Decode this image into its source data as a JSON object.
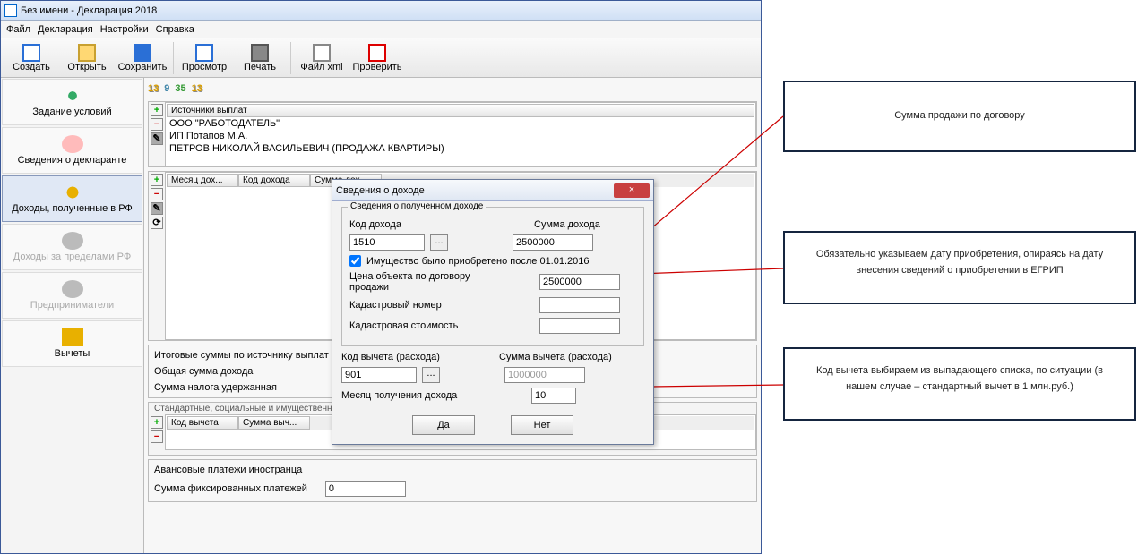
{
  "window": {
    "title": "Без имени - Декларация 2018"
  },
  "menu": {
    "file": "Файл",
    "decl": "Декларация",
    "settings": "Настройки",
    "help": "Справка"
  },
  "toolbar": {
    "create": "Создать",
    "open": "Открыть",
    "save": "Сохранить",
    "preview": "Просмотр",
    "print": "Печать",
    "xml": "Файл xml",
    "check": "Проверить"
  },
  "sidebar": {
    "conditions": "Задание условий",
    "declarant": "Сведения о декларанте",
    "income_rf": "Доходы, полученные в РФ",
    "income_abroad": "Доходы за пределами РФ",
    "entrepreneurs": "Предприниматели",
    "deductions": "Вычеты"
  },
  "nums": {
    "a": "13",
    "b": "9",
    "c": "35",
    "d": "13"
  },
  "sources": {
    "header": "Источники выплат",
    "rows": [
      "ООО \"РАБОТОДАТЕЛЬ\"",
      "ИП Потапов М.А.",
      "ПЕТРОВ НИКОЛАЙ ВАСИЛЬЕВИЧ (ПРОДАЖА КВАРТИРЫ)"
    ]
  },
  "income_table": {
    "cols": [
      "Месяц дох...",
      "Код дохода",
      "Сумма дох..."
    ]
  },
  "summary": {
    "title": "Итоговые суммы по источнику выплат",
    "total_income_label": "Общая сумма дохода",
    "tax_withheld_label": "Сумма налога удержанная"
  },
  "deduction_table": {
    "header": "Стандартные, социальные и имущественные",
    "cols": [
      "Код вычета",
      "Сумма выч..."
    ]
  },
  "advance": {
    "header": "Авансовые платежи иностранца",
    "label": "Сумма фиксированных платежей",
    "value": "0"
  },
  "dialog": {
    "title": "Сведения о доходе",
    "group_title": "Сведения о полученном доходе",
    "code_label": "Код дохода",
    "sum_label": "Сумма дохода",
    "code_value": "1510",
    "sum_value": "2500000",
    "checkbox": "Имущество было приобретено после 01.01.2016",
    "price_label": "Цена объекта по договору продажи",
    "price_value": "2500000",
    "cad_num_label": "Кадастровый номер",
    "cad_num_value": "",
    "cad_val_label": "Кадастровая стоимость",
    "cad_val_value": "",
    "ded_code_label": "Код вычета (расхода)",
    "ded_sum_label": "Сумма вычета (расхода)",
    "ded_code_value": "901",
    "ded_sum_value": "1000000",
    "month_label": "Месяц получения дохода",
    "month_value": "10",
    "ok": "Да",
    "cancel": "Нет"
  },
  "callouts": {
    "c1": "Сумма продажи по договору",
    "c2": "Обязательно указываем дату приобретения, опираясь на дату внесения сведений о приобретении в ЕГРИП",
    "c3": "Код вычета выбираем из выпадающего списка, по ситуации (в нашем случае – стандартный вычет в 1 млн.руб.)"
  }
}
